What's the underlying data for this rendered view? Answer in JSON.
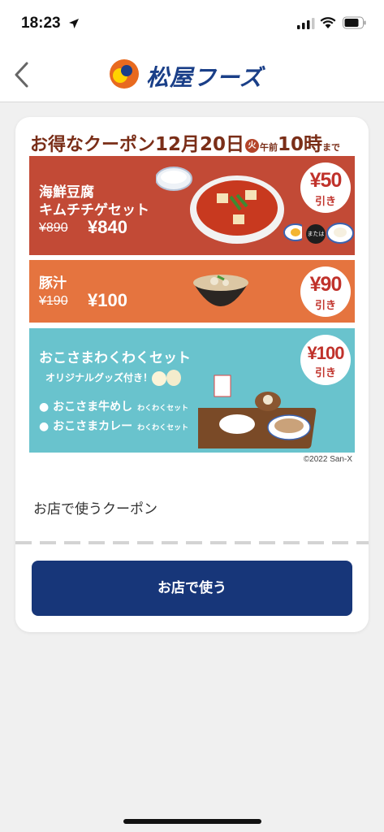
{
  "status_bar": {
    "time": "18:23"
  },
  "header": {
    "brand": "松屋フーズ"
  },
  "coupon": {
    "title": {
      "lead": "お得なクーポン",
      "month_day": "12月20日",
      "weekday": "火",
      "ampm": "午前",
      "hour": "10時",
      "until": "まで"
    },
    "items": [
      {
        "name_line1": "海鮮豆腐",
        "name_line2": "キムチチゲセット",
        "old_price": "¥890",
        "new_price": "¥840",
        "discount": "¥50",
        "discount_label": "引き",
        "option_label": "または"
      },
      {
        "name_line1": "豚汁",
        "old_price": "¥190",
        "new_price": "¥100",
        "discount": "¥90",
        "discount_label": "引き"
      },
      {
        "name_line1": "おこさまわくわくセット",
        "subtitle": "オリジナルグッズ付き！",
        "sub_items": [
          {
            "label": "● おこさま牛めし",
            "tag": "わくわくセット"
          },
          {
            "label": "● おこさまカレー",
            "tag": "わくわくセット"
          }
        ],
        "discount": "¥100",
        "discount_label": "引き"
      }
    ],
    "copyright": "©2022 San-X",
    "section_label": "お店で使うクーポン",
    "use_button": "お店で使う"
  },
  "colors": {
    "panel1": "#c24a36",
    "panel2": "#e5743f",
    "panel3": "#69c3cd",
    "button": "#173679",
    "title": "#7a2e18"
  }
}
